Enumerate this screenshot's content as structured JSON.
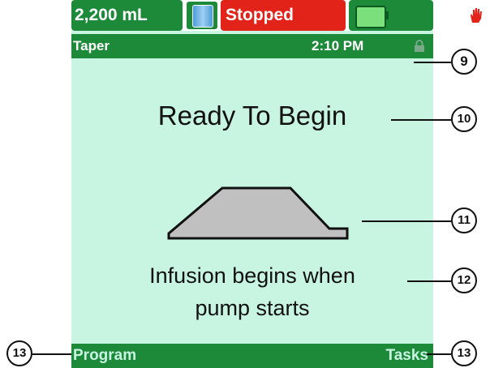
{
  "status_bar": {
    "volume": "2,200 mL",
    "status": "Stopped",
    "bag_icon": "iv-bag-icon",
    "hand_icon": "stop-hand-icon",
    "battery_icon": "battery-icon"
  },
  "header": {
    "title": "Taper",
    "time": "2:10 PM",
    "lock_icon": "lock-icon"
  },
  "main": {
    "title": "Ready To Begin",
    "profile_icon": "taper-profile-graphic",
    "info_line1": "Infusion begins when",
    "info_line2": "pump starts"
  },
  "softkeys": {
    "left": "Program",
    "right": "Tasks"
  },
  "callouts": {
    "c9": "9",
    "c10": "10",
    "c11": "11",
    "c12": "12",
    "c13_left": "13",
    "c13_right": "13"
  },
  "colors": {
    "bar_green": "#1d8a3a",
    "screen_bg": "#c8f4e2",
    "status_red": "#e2231a"
  }
}
